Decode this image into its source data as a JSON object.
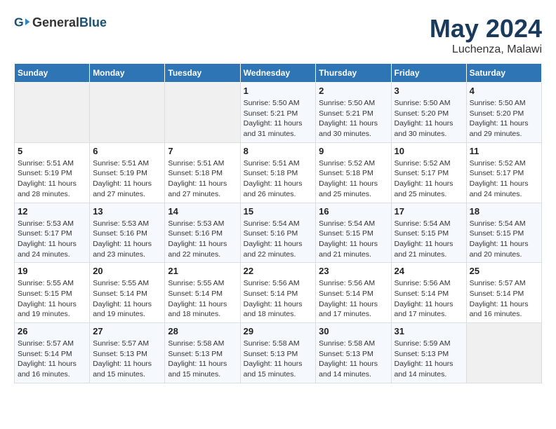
{
  "header": {
    "logo_general": "General",
    "logo_blue": "Blue",
    "title": "May 2024",
    "subtitle": "Luchenza, Malawi"
  },
  "weekdays": [
    "Sunday",
    "Monday",
    "Tuesday",
    "Wednesday",
    "Thursday",
    "Friday",
    "Saturday"
  ],
  "weeks": [
    [
      {
        "day": "",
        "sunrise": "",
        "sunset": "",
        "daylight": ""
      },
      {
        "day": "",
        "sunrise": "",
        "sunset": "",
        "daylight": ""
      },
      {
        "day": "",
        "sunrise": "",
        "sunset": "",
        "daylight": ""
      },
      {
        "day": "1",
        "sunrise": "Sunrise: 5:50 AM",
        "sunset": "Sunset: 5:21 PM",
        "daylight": "Daylight: 11 hours and 31 minutes."
      },
      {
        "day": "2",
        "sunrise": "Sunrise: 5:50 AM",
        "sunset": "Sunset: 5:21 PM",
        "daylight": "Daylight: 11 hours and 30 minutes."
      },
      {
        "day": "3",
        "sunrise": "Sunrise: 5:50 AM",
        "sunset": "Sunset: 5:20 PM",
        "daylight": "Daylight: 11 hours and 30 minutes."
      },
      {
        "day": "4",
        "sunrise": "Sunrise: 5:50 AM",
        "sunset": "Sunset: 5:20 PM",
        "daylight": "Daylight: 11 hours and 29 minutes."
      }
    ],
    [
      {
        "day": "5",
        "sunrise": "Sunrise: 5:51 AM",
        "sunset": "Sunset: 5:19 PM",
        "daylight": "Daylight: 11 hours and 28 minutes."
      },
      {
        "day": "6",
        "sunrise": "Sunrise: 5:51 AM",
        "sunset": "Sunset: 5:19 PM",
        "daylight": "Daylight: 11 hours and 27 minutes."
      },
      {
        "day": "7",
        "sunrise": "Sunrise: 5:51 AM",
        "sunset": "Sunset: 5:18 PM",
        "daylight": "Daylight: 11 hours and 27 minutes."
      },
      {
        "day": "8",
        "sunrise": "Sunrise: 5:51 AM",
        "sunset": "Sunset: 5:18 PM",
        "daylight": "Daylight: 11 hours and 26 minutes."
      },
      {
        "day": "9",
        "sunrise": "Sunrise: 5:52 AM",
        "sunset": "Sunset: 5:18 PM",
        "daylight": "Daylight: 11 hours and 25 minutes."
      },
      {
        "day": "10",
        "sunrise": "Sunrise: 5:52 AM",
        "sunset": "Sunset: 5:17 PM",
        "daylight": "Daylight: 11 hours and 25 minutes."
      },
      {
        "day": "11",
        "sunrise": "Sunrise: 5:52 AM",
        "sunset": "Sunset: 5:17 PM",
        "daylight": "Daylight: 11 hours and 24 minutes."
      }
    ],
    [
      {
        "day": "12",
        "sunrise": "Sunrise: 5:53 AM",
        "sunset": "Sunset: 5:17 PM",
        "daylight": "Daylight: 11 hours and 24 minutes."
      },
      {
        "day": "13",
        "sunrise": "Sunrise: 5:53 AM",
        "sunset": "Sunset: 5:16 PM",
        "daylight": "Daylight: 11 hours and 23 minutes."
      },
      {
        "day": "14",
        "sunrise": "Sunrise: 5:53 AM",
        "sunset": "Sunset: 5:16 PM",
        "daylight": "Daylight: 11 hours and 22 minutes."
      },
      {
        "day": "15",
        "sunrise": "Sunrise: 5:54 AM",
        "sunset": "Sunset: 5:16 PM",
        "daylight": "Daylight: 11 hours and 22 minutes."
      },
      {
        "day": "16",
        "sunrise": "Sunrise: 5:54 AM",
        "sunset": "Sunset: 5:15 PM",
        "daylight": "Daylight: 11 hours and 21 minutes."
      },
      {
        "day": "17",
        "sunrise": "Sunrise: 5:54 AM",
        "sunset": "Sunset: 5:15 PM",
        "daylight": "Daylight: 11 hours and 21 minutes."
      },
      {
        "day": "18",
        "sunrise": "Sunrise: 5:54 AM",
        "sunset": "Sunset: 5:15 PM",
        "daylight": "Daylight: 11 hours and 20 minutes."
      }
    ],
    [
      {
        "day": "19",
        "sunrise": "Sunrise: 5:55 AM",
        "sunset": "Sunset: 5:15 PM",
        "daylight": "Daylight: 11 hours and 19 minutes."
      },
      {
        "day": "20",
        "sunrise": "Sunrise: 5:55 AM",
        "sunset": "Sunset: 5:14 PM",
        "daylight": "Daylight: 11 hours and 19 minutes."
      },
      {
        "day": "21",
        "sunrise": "Sunrise: 5:55 AM",
        "sunset": "Sunset: 5:14 PM",
        "daylight": "Daylight: 11 hours and 18 minutes."
      },
      {
        "day": "22",
        "sunrise": "Sunrise: 5:56 AM",
        "sunset": "Sunset: 5:14 PM",
        "daylight": "Daylight: 11 hours and 18 minutes."
      },
      {
        "day": "23",
        "sunrise": "Sunrise: 5:56 AM",
        "sunset": "Sunset: 5:14 PM",
        "daylight": "Daylight: 11 hours and 17 minutes."
      },
      {
        "day": "24",
        "sunrise": "Sunrise: 5:56 AM",
        "sunset": "Sunset: 5:14 PM",
        "daylight": "Daylight: 11 hours and 17 minutes."
      },
      {
        "day": "25",
        "sunrise": "Sunrise: 5:57 AM",
        "sunset": "Sunset: 5:14 PM",
        "daylight": "Daylight: 11 hours and 16 minutes."
      }
    ],
    [
      {
        "day": "26",
        "sunrise": "Sunrise: 5:57 AM",
        "sunset": "Sunset: 5:14 PM",
        "daylight": "Daylight: 11 hours and 16 minutes."
      },
      {
        "day": "27",
        "sunrise": "Sunrise: 5:57 AM",
        "sunset": "Sunset: 5:13 PM",
        "daylight": "Daylight: 11 hours and 15 minutes."
      },
      {
        "day": "28",
        "sunrise": "Sunrise: 5:58 AM",
        "sunset": "Sunset: 5:13 PM",
        "daylight": "Daylight: 11 hours and 15 minutes."
      },
      {
        "day": "29",
        "sunrise": "Sunrise: 5:58 AM",
        "sunset": "Sunset: 5:13 PM",
        "daylight": "Daylight: 11 hours and 15 minutes."
      },
      {
        "day": "30",
        "sunrise": "Sunrise: 5:58 AM",
        "sunset": "Sunset: 5:13 PM",
        "daylight": "Daylight: 11 hours and 14 minutes."
      },
      {
        "day": "31",
        "sunrise": "Sunrise: 5:59 AM",
        "sunset": "Sunset: 5:13 PM",
        "daylight": "Daylight: 11 hours and 14 minutes."
      },
      {
        "day": "",
        "sunrise": "",
        "sunset": "",
        "daylight": ""
      }
    ]
  ]
}
